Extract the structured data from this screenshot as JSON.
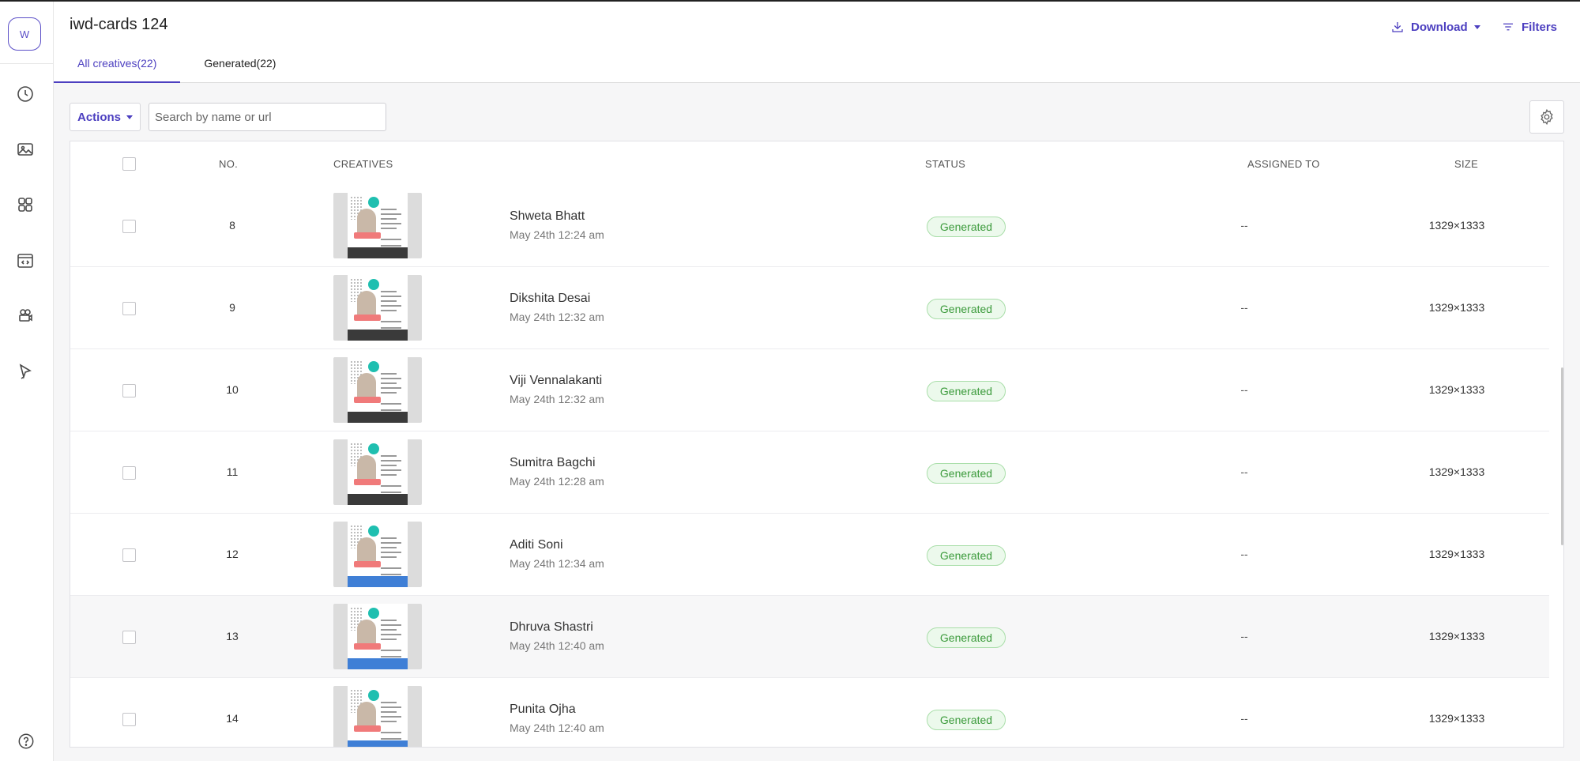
{
  "app": {
    "avatar_initial": "W",
    "title": "iwd-cards 124"
  },
  "header": {
    "download_label": "Download",
    "filters_label": "Filters",
    "tabs": [
      {
        "label": "All creatives(22)",
        "active": true
      },
      {
        "label": "Generated(22)",
        "active": false
      }
    ]
  },
  "toolbar": {
    "actions_label": "Actions",
    "search_placeholder": "Search by name or url"
  },
  "table": {
    "columns": {
      "no": "NO.",
      "creatives": "CREATIVES",
      "status": "STATUS",
      "assigned_to": "ASSIGNED TO",
      "size": "SIZE"
    },
    "rows": [
      {
        "no": "8",
        "name": "Shweta Bhatt",
        "date": "May 24th 12:24 am",
        "status": "Generated",
        "assigned": "--",
        "size": "1329×1333",
        "theme": "dark"
      },
      {
        "no": "9",
        "name": "Dikshita Desai",
        "date": "May 24th 12:32 am",
        "status": "Generated",
        "assigned": "--",
        "size": "1329×1333",
        "theme": "dark"
      },
      {
        "no": "10",
        "name": "Viji Vennalakanti",
        "date": "May 24th 12:32 am",
        "status": "Generated",
        "assigned": "--",
        "size": "1329×1333",
        "theme": "dark"
      },
      {
        "no": "11",
        "name": "Sumitra Bagchi",
        "date": "May 24th 12:28 am",
        "status": "Generated",
        "assigned": "--",
        "size": "1329×1333",
        "theme": "dark"
      },
      {
        "no": "12",
        "name": "Aditi Soni",
        "date": "May 24th 12:34 am",
        "status": "Generated",
        "assigned": "--",
        "size": "1329×1333",
        "theme": "blue"
      },
      {
        "no": "13",
        "name": "Dhruva Shastri",
        "date": "May 24th 12:40 am",
        "status": "Generated",
        "assigned": "--",
        "size": "1329×1333",
        "theme": "blue"
      },
      {
        "no": "14",
        "name": "Punita Ojha",
        "date": "May 24th 12:40 am",
        "status": "Generated",
        "assigned": "--",
        "size": "1329×1333",
        "theme": "blue"
      }
    ]
  },
  "colors": {
    "accent": "#4c3fc0",
    "status_green": "#3b9a3b"
  }
}
